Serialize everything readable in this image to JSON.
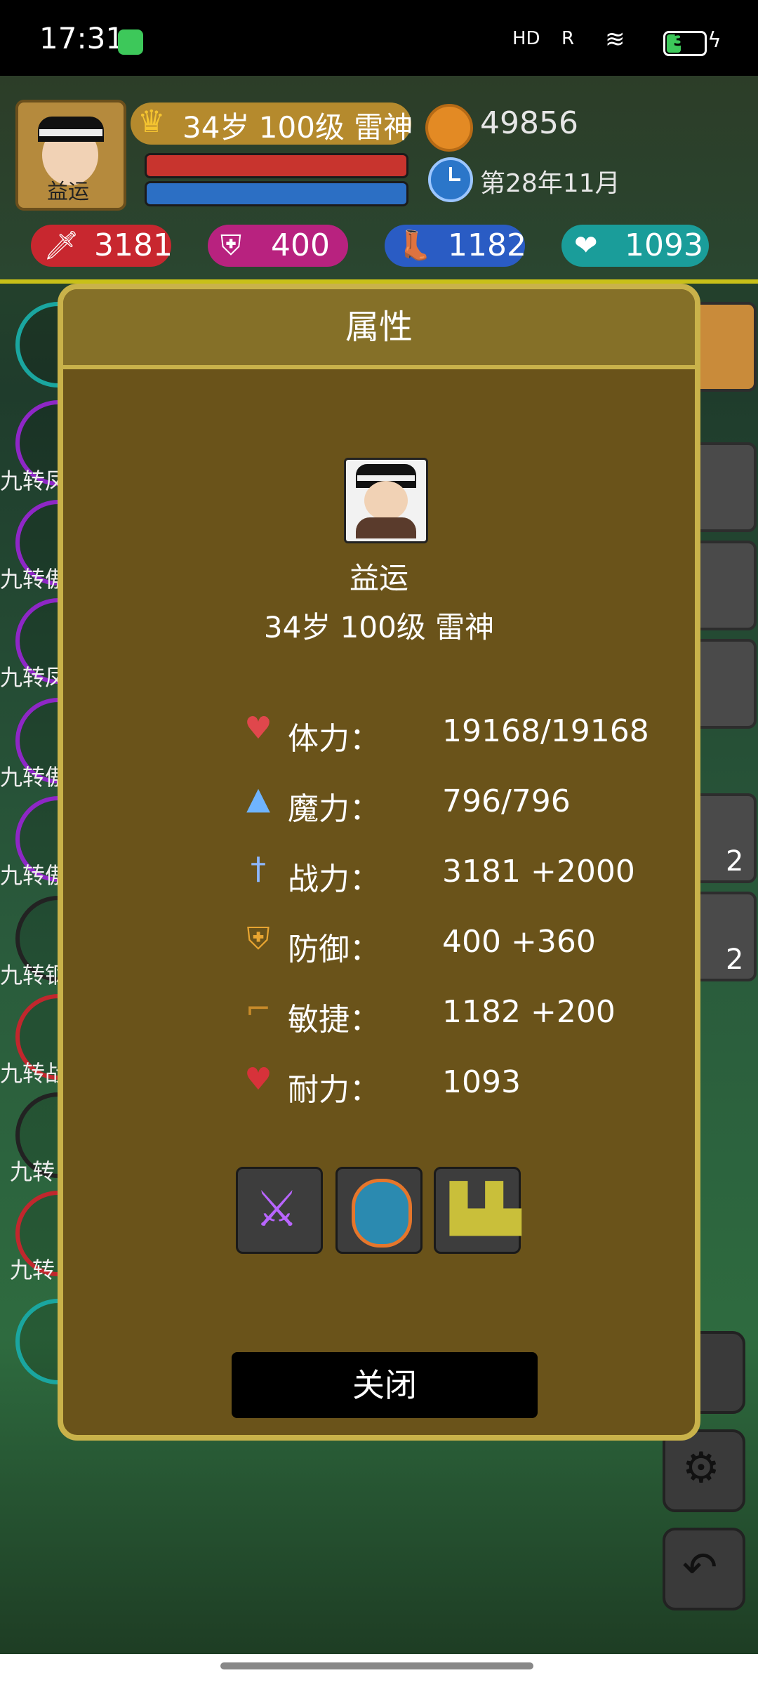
{
  "status_bar": {
    "time": "17:31",
    "signal_1": "HD",
    "signal_2": "R",
    "battery": "36"
  },
  "top_bar": {
    "avatar_name": "益运",
    "level_text": "34岁 100级 雷神",
    "coins": "49856",
    "date": "第28年11月",
    "stats": {
      "attack": "3181",
      "defense": "400",
      "agility": "1182",
      "endurance": "1093"
    }
  },
  "side": {
    "labels": [
      "九转凤",
      "九转傲",
      "九转凤",
      "九转傲",
      "九转傲",
      "九转钢",
      "九转战",
      "九转",
      "九转"
    ],
    "slot_counts": [
      "2",
      "2"
    ]
  },
  "dialog": {
    "title": "属性",
    "name": "益运",
    "line": "34岁 100级 雷神",
    "stats": [
      {
        "icon": "heart-icon",
        "label": "体力：",
        "value": "19168/19168"
      },
      {
        "icon": "mana-bottle-icon",
        "label": "魔力：",
        "value": "796/796"
      },
      {
        "icon": "sword-icon",
        "label": "战力：",
        "value": "3181 +2000"
      },
      {
        "icon": "shield-icon",
        "label": "防御：",
        "value": "400 +360"
      },
      {
        "icon": "boot-icon",
        "label": "敏捷：",
        "value": "1182 +200"
      },
      {
        "icon": "heart-plus-icon",
        "label": "耐力：",
        "value": "1093"
      }
    ],
    "close_label": "关闭"
  },
  "colors": {
    "dialog_bg": "#6a531a",
    "dialog_border": "#c9b24a",
    "header_bg": "#857028"
  }
}
